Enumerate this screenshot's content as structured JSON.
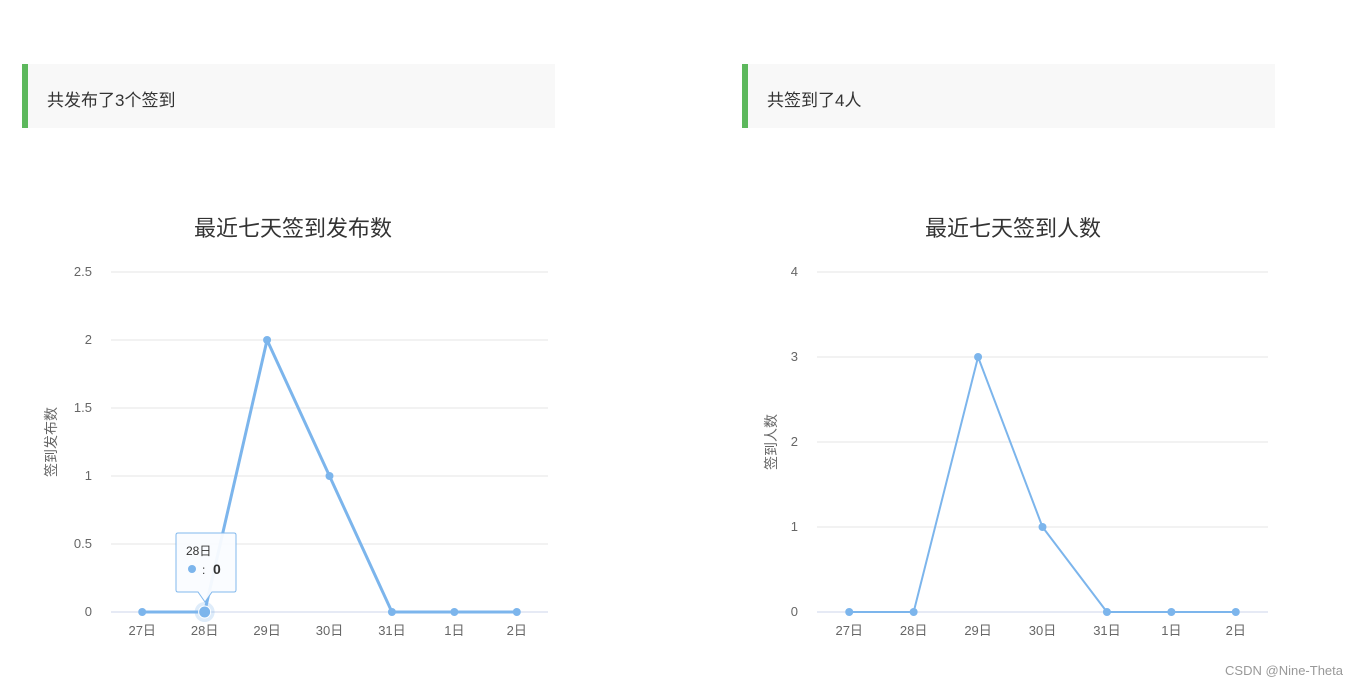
{
  "panels": [
    {
      "header": "共发布了3个签到",
      "chart_title": "最近七天签到发布数",
      "ylabel": "签到发布数"
    },
    {
      "header": "共签到了4人",
      "chart_title": "最近七天签到人数",
      "ylabel": "签到人数"
    }
  ],
  "tooltip": {
    "date": "28日",
    "value_text": "0"
  },
  "watermark": "CSDN @Nine-Theta",
  "colors": {
    "series": "#7cb5ec",
    "accent_bar": "#5cb85c",
    "grid": "#e6e6e6",
    "header_bg": "#f8f8f8"
  },
  "chart_data": [
    {
      "type": "line",
      "title": "最近七天签到发布数",
      "ylabel": "签到发布数",
      "categories": [
        "27日",
        "28日",
        "29日",
        "30日",
        "31日",
        "1日",
        "2日"
      ],
      "values": [
        0,
        0,
        2,
        1,
        0,
        0,
        0
      ],
      "yticks": [
        "0",
        "0.5",
        "1",
        "1.5",
        "2",
        "2.5"
      ],
      "ylim": [
        0,
        2.5
      ],
      "grid": true,
      "highlighted_category": "28日"
    },
    {
      "type": "line",
      "title": "最近七天签到人数",
      "ylabel": "签到人数",
      "categories": [
        "27日",
        "28日",
        "29日",
        "30日",
        "31日",
        "1日",
        "2日"
      ],
      "values": [
        0,
        0,
        3,
        1,
        0,
        0,
        0
      ],
      "yticks": [
        "0",
        "1",
        "2",
        "3",
        "4"
      ],
      "ylim": [
        0,
        4
      ],
      "grid": true
    }
  ]
}
